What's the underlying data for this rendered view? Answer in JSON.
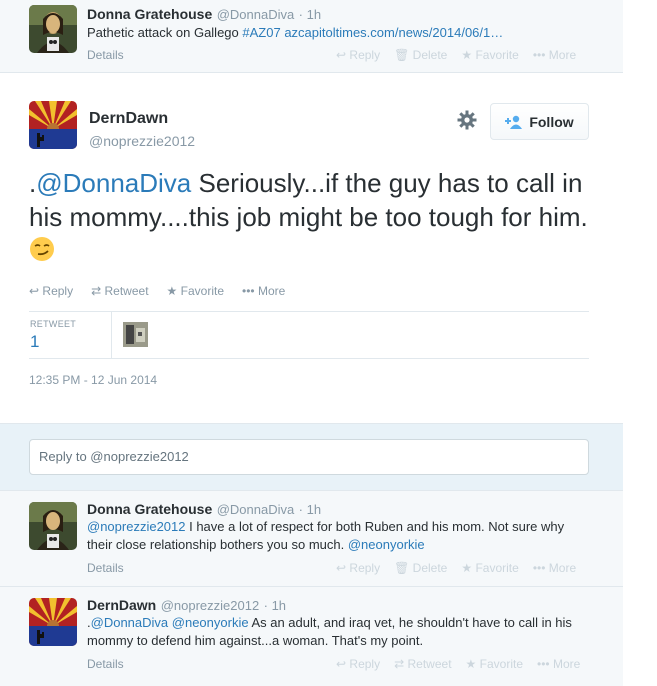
{
  "parent_tweet": {
    "name": "Donna Gratehouse",
    "screen_name": "@DonnaDiva",
    "time": "· 1h",
    "text_prefix": "Pathetic attack on Gallego ",
    "hashtag": "#AZ07",
    "url": "azcapitoltimes.com/news/2014/06/1…",
    "details": "Details",
    "actions": [
      "Reply",
      "Delete",
      "Favorite",
      "More"
    ]
  },
  "main_tweet": {
    "name": "DernDawn",
    "screen_name": "@noprezzie2012",
    "follow_label": "Follow",
    "text_mention": "@DonnaDiva",
    "text_prefix": ".",
    "text_body": " Seriously...if the guy has to call in his mommy....this job might be too tough for him. ",
    "emoji": "😏",
    "actions": [
      "Reply",
      "Retweet",
      "Favorite",
      "More"
    ],
    "retweet_label": "RETWEET",
    "retweet_count": "1",
    "timestamp": "12:35 PM - 12 Jun 2014"
  },
  "reply_box": {
    "placeholder": "Reply to @noprezzie2012"
  },
  "replies": [
    {
      "name": "Donna Gratehouse",
      "screen_name": "@DonnaDiva",
      "time": "· 1h",
      "mention": "@noprezzie2012",
      "text": " I have a lot of respect for both Ruben and his mom. Not sure why their close relationship bothers you so much. ",
      "mention2": "@neonyorkie",
      "details": "Details",
      "actions": [
        "Reply",
        "Delete",
        "Favorite",
        "More"
      ]
    },
    {
      "name": "DernDawn",
      "screen_name": "@noprezzie2012",
      "time": "· 1h",
      "prefix": ".",
      "mention": "@DonnaDiva",
      "mention2": "@neonyorkie",
      "text": " As an adult, and iraq vet, he shouldn't have to call in his mommy to defend him against...a woman. That's my point.",
      "details": "Details",
      "actions": [
        "Reply",
        "Retweet",
        "Favorite",
        "More"
      ]
    }
  ],
  "colors": {
    "link": "#2b7bb9",
    "muted": "#8899a6",
    "text": "#292f33",
    "light_bg": "#f5f8fa",
    "reply_bg": "#e8f2f8"
  }
}
